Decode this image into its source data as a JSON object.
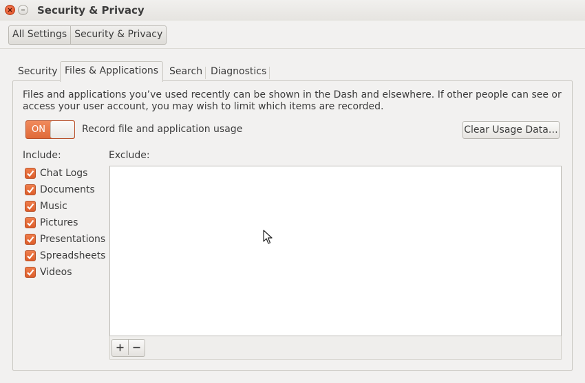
{
  "window": {
    "title": "Security & Privacy"
  },
  "breadcrumb": {
    "items": [
      {
        "label": "All Settings"
      },
      {
        "label": "Security & Privacy"
      }
    ]
  },
  "tabs": [
    {
      "label": "Security",
      "active": false
    },
    {
      "label": "Files & Applications",
      "active": true
    },
    {
      "label": "Search",
      "active": false
    },
    {
      "label": "Diagnostics",
      "active": false
    }
  ],
  "files_apps": {
    "description": "Files and applications you’ve used recently can be shown in the Dash and elsewhere. If other people can see or access your user account, you may wish to limit which items are recorded.",
    "record_switch": {
      "state_label": "ON",
      "on": true
    },
    "record_caption": "Record file and application usage",
    "clear_button": "Clear Usage Data…",
    "include_label": "Include:",
    "exclude_label": "Exclude:",
    "include_items": [
      {
        "label": "Chat Logs",
        "checked": true
      },
      {
        "label": "Documents",
        "checked": true
      },
      {
        "label": "Music",
        "checked": true
      },
      {
        "label": "Pictures",
        "checked": true
      },
      {
        "label": "Presentations",
        "checked": true
      },
      {
        "label": "Spreadsheets",
        "checked": true
      },
      {
        "label": "Videos",
        "checked": true
      }
    ],
    "exclude_items": [],
    "add_icon": "plus-icon",
    "remove_icon": "minus-icon"
  },
  "colors": {
    "accent": "#e46a3a",
    "window_bg": "#f2f1f0",
    "close_button": "#e5532a"
  }
}
